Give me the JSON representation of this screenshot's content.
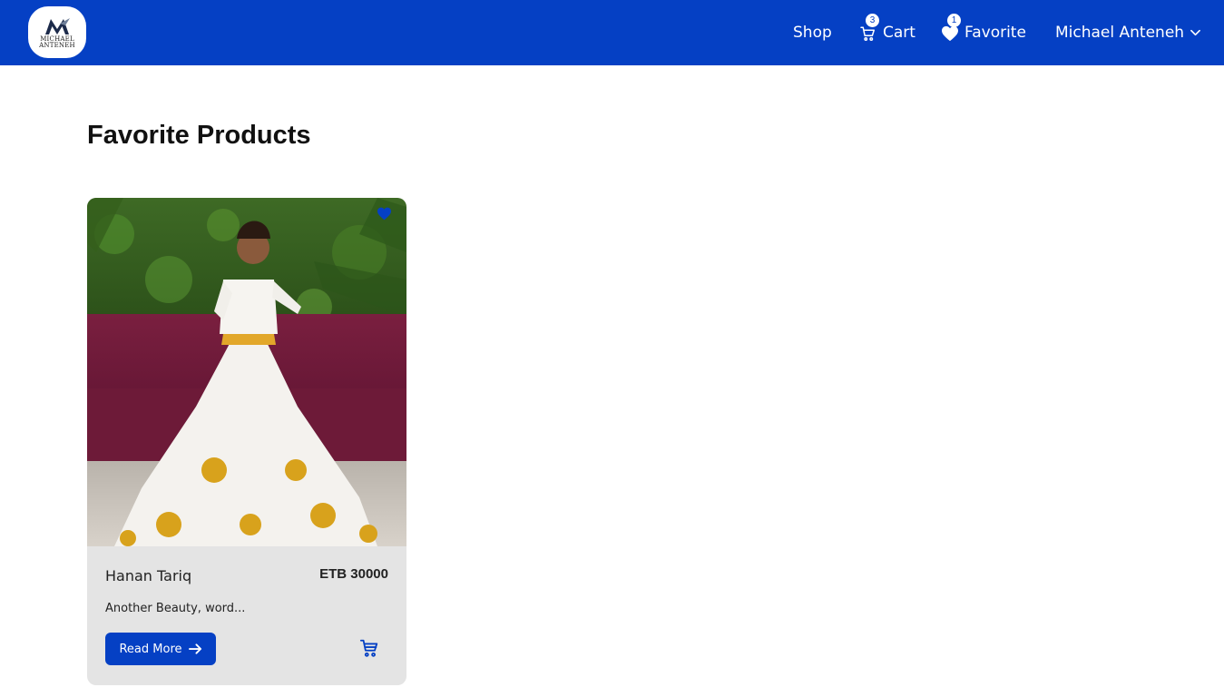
{
  "navbar": {
    "logo": {
      "line1": "MICHAEL",
      "line2": "ANTENEH",
      "icon": "brand-logo"
    },
    "shop_label": "Shop",
    "cart": {
      "label": "Cart",
      "count": "3",
      "icon": "cart-icon"
    },
    "favorite": {
      "label": "Favorite",
      "count": "1",
      "icon": "heart-icon"
    },
    "user": {
      "name": "Michael Anteneh",
      "icon": "chevron-down-icon"
    }
  },
  "main": {
    "title": "Favorite Products",
    "products": [
      {
        "name": "Hanan Tariq",
        "price": "ETB 30000",
        "description": "Another Beauty, word...",
        "read_more_label": "Read More",
        "favorited": true
      }
    ]
  },
  "colors": {
    "primary": "#0540c4",
    "card_bg": "#e4e4e4",
    "text": "#111111"
  }
}
